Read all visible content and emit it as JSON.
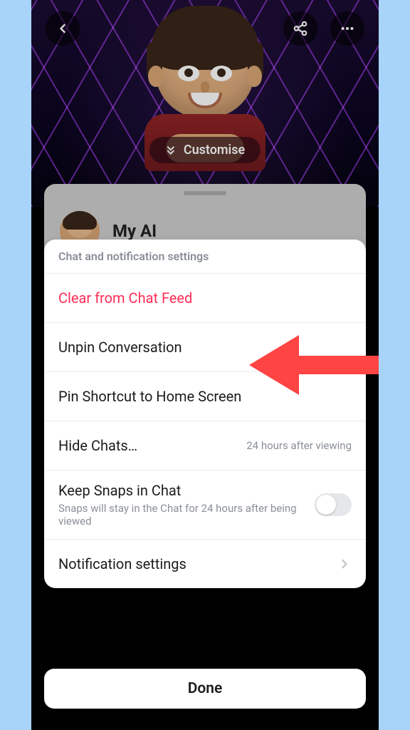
{
  "header": {
    "customise_label": "Customise"
  },
  "profile": {
    "name": "My AI"
  },
  "sheet": {
    "title": "Chat and notification settings",
    "items": {
      "clear": "Clear from Chat Feed",
      "unpin": "Unpin Conversation",
      "pinShortcut": "Pin Shortcut to Home Screen",
      "hideChats": "Hide Chats…",
      "hideChatsValue": "24 hours after viewing",
      "keepSnaps": "Keep Snaps in Chat",
      "keepSnapsSub": "Snaps will stay in the Chat for 24 hours after being viewed",
      "notificationSettings": "Notification settings"
    }
  },
  "done_label": "Done",
  "colors": {
    "danger": "#ff2d55",
    "bgBlue": "#a8d4fa"
  }
}
